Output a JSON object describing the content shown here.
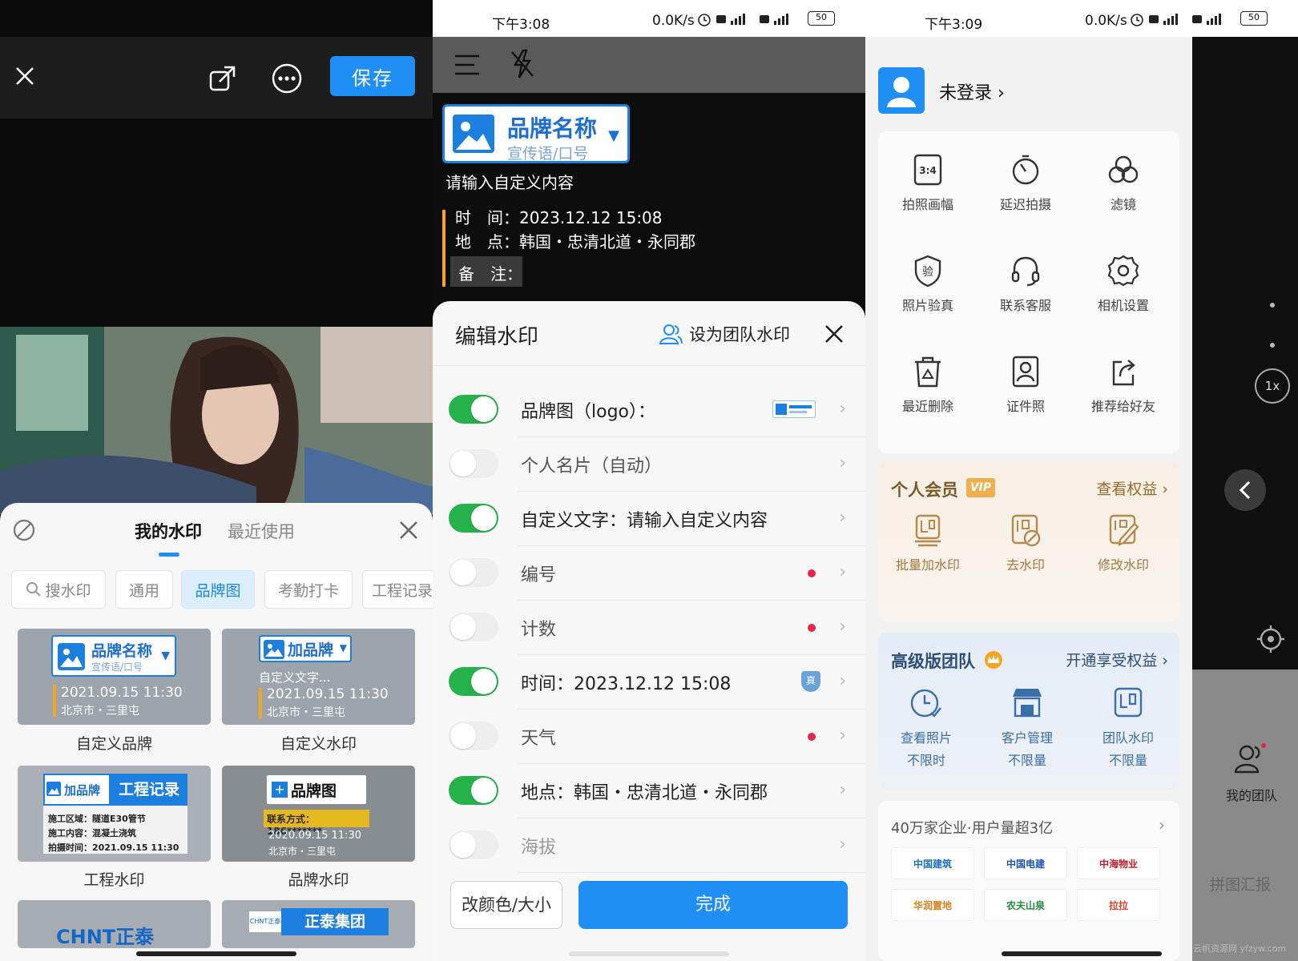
{
  "panel1": {
    "save_label": "保存",
    "tabs": {
      "mine": "我的水印",
      "recent": "最近使用"
    },
    "chips": [
      "搜水印",
      "通用",
      "品牌图",
      "考勤打卡",
      "工程记录"
    ],
    "cards": [
      {
        "brand": "品牌名称",
        "slogan": "宣传语/口号",
        "time": "2021.09.15  11:30",
        "place": "北京市・三里屯",
        "caption": "自定义品牌"
      },
      {
        "brand": "加品牌",
        "text": "自定义文字...",
        "time": "2021.09.15  11:30",
        "place": "北京市・三里屯",
        "caption": "自定义水印"
      },
      {
        "brand": "加品牌",
        "title": "工程记录",
        "area": "施工区域：隧道E30管节",
        "content": "施工内容：混凝土浇筑",
        "time": "拍摄时间：2021.09.15 11:30",
        "caption": "工程水印"
      },
      {
        "brand": "品牌图",
        "contact": "联系方式：186*******",
        "time": "2020.09.15  11:30",
        "place": "北京市・三里屯",
        "caption": "品牌水印"
      },
      {
        "logo": "CHNT正泰"
      },
      {
        "logo_small": "CHNT正泰",
        "name": "正泰集团"
      }
    ]
  },
  "panel2": {
    "status": {
      "time": "下午3:08",
      "speed": "0.0K/s",
      "battery": "50"
    },
    "preview": {
      "brand": "品牌名称",
      "slogan": "宣传语/口号",
      "custom": "请输入自定义内容",
      "time_label": "时　间：",
      "time_value": "2023.12.12 15:08",
      "place_label": "地　点：",
      "place_value": "韩国・忠清北道・永同郡",
      "note_label": "备　注："
    },
    "sheet": {
      "title": "编辑水印",
      "team": "设为团队水印",
      "rows": [
        {
          "label": "品牌图（logo）：",
          "on": true
        },
        {
          "label": "个人名片（自动）",
          "on": false
        },
        {
          "label": "自定义文字：请输入自定义内容",
          "on": true
        },
        {
          "label": "编号",
          "on": false
        },
        {
          "label": "计数",
          "on": false
        },
        {
          "label": "时间：2023.12.12 15:08",
          "on": true
        },
        {
          "label": "天气",
          "on": false
        },
        {
          "label": "地点：韩国・忠清北道・永同郡",
          "on": true
        },
        {
          "label": "海拔",
          "on": false
        }
      ],
      "verified_badge": "真",
      "color_button": "改颜色/大小",
      "done_button": "完成"
    }
  },
  "panel3": {
    "status": {
      "time": "下午3:09",
      "speed": "0.0K/s",
      "battery": "50"
    },
    "login": "未登录",
    "grid": [
      "拍照画幅",
      "延迟拍摄",
      "滤镜",
      "照片验真",
      "联系客服",
      "相机设置",
      "最近删除",
      "证件照",
      "推荐给好友"
    ],
    "aspect_icon": "3:4",
    "verify_icon": "验",
    "vip": {
      "title": "个人会员",
      "badge": "VIP",
      "link": "查看权益",
      "items": [
        "批量加水印",
        "去水印",
        "修改水印"
      ]
    },
    "team": {
      "title": "高级版团队",
      "link": "开通享受权益",
      "items": [
        {
          "l1": "查看照片",
          "l2": "不限时"
        },
        {
          "l1": "客户管理",
          "l2": "不限量"
        },
        {
          "l1": "团队水印",
          "l2": "不限量"
        }
      ]
    },
    "enterprise": {
      "title": "40万家企业·用户量超3亿",
      "logos": [
        "中国建筑",
        "中国电建",
        "中海物业",
        "华润置地",
        "农夫山泉",
        "拉拉"
      ]
    },
    "side": {
      "zoom": "1x",
      "team": "我的团队",
      "report": "拼图汇报"
    },
    "watermark": "@云帆资源网 yfzyw.com"
  },
  "colors": {
    "blue": "#1f8ff5",
    "green": "#26b24b",
    "orange": "#f5a524",
    "red": "#e8244c"
  }
}
